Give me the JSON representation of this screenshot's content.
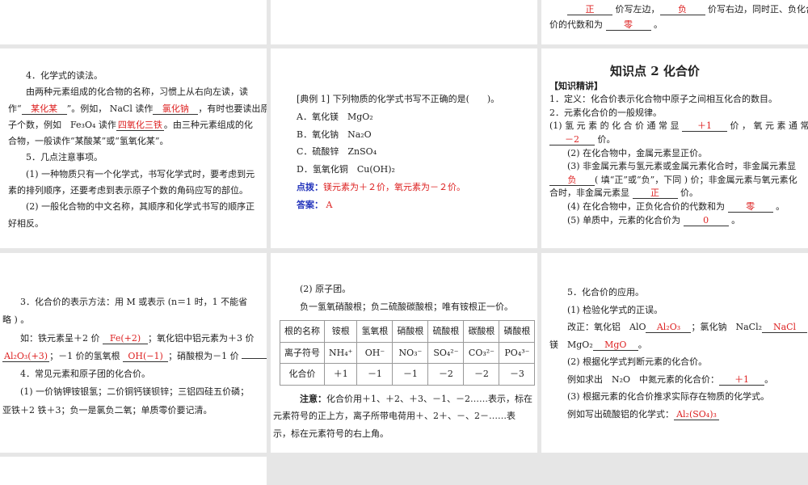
{
  "panels": [
    {
      "lines": []
    },
    {
      "lines": []
    },
    {
      "lines": [
        [
          {
            "t": "　　"
          },
          {
            "t": "正",
            "k": "blank"
          },
          {
            "t": " 价写左边，"
          },
          {
            "t": "负",
            "k": "blank"
          },
          {
            "t": " 价写右边，同时正、负化合"
          }
        ],
        [
          {
            "t": "价的代数和为 "
          },
          {
            "t": "零",
            "k": "blank"
          },
          {
            "t": " 。"
          }
        ]
      ]
    },
    {
      "lines": [
        [
          {
            "t": "　　4．化学式的读法。"
          }
        ],
        [
          {
            "t": "　　由两种元素组成的化合物的名称，习惯上从右向左读，读"
          }
        ],
        [
          {
            "t": "作“"
          },
          {
            "t": "某化某",
            "k": "blank"
          },
          {
            "t": "”。例如， NaCl 读作"
          },
          {
            "t": "氯化钠",
            "k": "blank"
          },
          {
            "t": "，有时也要读出原"
          }
        ],
        [
          {
            "t": "子个数，例如　Fe₃O₄ 读作"
          },
          {
            "t": "四氧化三铁",
            "k": "blank"
          },
          {
            "t": "。由三种元素组成的化"
          }
        ],
        [
          {
            "t": "合物，一般读作“某酸某”或“氢氧化某”。"
          }
        ],
        [
          {
            "t": "　　5．几点注意事项。"
          }
        ],
        [
          {
            "t": "　　(1) 一种物质只有一个化学式，书写化学式时，要考虑到元"
          }
        ],
        [
          {
            "t": "素的排列顺序，还要考虑到表示原子个数的角码应写的部位。"
          }
        ],
        [
          {
            "t": "　　(2) 一般化合物的中文名称，其顺序和化学式书写的顺序正"
          }
        ],
        [
          {
            "t": "好相反。"
          }
        ]
      ]
    },
    {
      "lines": [
        [
          {
            "t": "[典例 1]  下列物质的化学式书写不正确的是(　　)。"
          }
        ],
        [
          {
            "t": "A．氧化镁　MgO₂"
          }
        ],
        [
          {
            "t": "B．氧化钠　Na₂O"
          }
        ],
        [
          {
            "t": "C．硫酸锌　ZnSO₄"
          }
        ],
        [
          {
            "t": "D．氢氧化铜　Cu(OH)₂"
          }
        ],
        [
          {
            "t": "点拨：",
            "k": "blue"
          },
          {
            "t": "镁元素为＋２价，氧元素为－２价。",
            "k": "red"
          }
        ],
        [
          {
            "t": "答案：",
            "k": "blue"
          },
          {
            "t": " A",
            "k": "red"
          }
        ]
      ]
    },
    {
      "lines": [
        [
          {
            "t": "　　　　　知识点 2 化合价",
            "k": "big"
          }
        ],
        [
          {
            "t": "【知识精讲】",
            "k": "bold"
          }
        ],
        [
          {
            "t": "1．定义：化合价表示化合物中原子之间相互化合的数目。"
          }
        ],
        [
          {
            "t": "2．元素化合价的一般规律。"
          }
        ],
        [
          {
            "t": "(1) 氢 元 素 的 化 合 价 通 常 显 "
          },
          {
            "t": "＋1",
            "k": "blank"
          },
          {
            "t": " 价 ， 氧 元 素 通 常"
          }
        ],
        [
          {
            "t": "－2",
            "k": "blank"
          },
          {
            "t": " 价。"
          }
        ],
        [
          {
            "t": "　　(2) 在化合物中，金属元素显正价。"
          }
        ],
        [
          {
            "t": "　　(3) 非金属元素与氢元素或金属元素化合时，非金属元素显"
          }
        ],
        [
          {
            "t": "负",
            "k": "blank"
          },
          {
            "t": "( 填“正”或“负”，下同 ) 价；非金属元素与氧元素化"
          }
        ],
        [
          {
            "t": "合时，非金属元素显 "
          },
          {
            "t": "正",
            "k": "blank"
          },
          {
            "t": " 价。"
          }
        ],
        [
          {
            "t": "　　(4) 在化合物中，正负化合价的代数和为 "
          },
          {
            "t": "零",
            "k": "blank"
          },
          {
            "t": " 。"
          }
        ],
        [
          {
            "t": "　　(5) 单质中，元素的化合价为 "
          },
          {
            "t": "0",
            "k": "blank"
          },
          {
            "t": " 。"
          }
        ]
      ]
    },
    {
      "lines": [
        [
          {
            "t": "　　3．化合价的表示方法：用 M 或表示 (n＝1 时，1 不能省"
          }
        ],
        [
          {
            "t": "略 ) 。"
          }
        ],
        [
          {
            "t": "　　如：铁元素呈＋2 价 "
          },
          {
            "t": "Fe(+2)",
            "k": "blank"
          },
          {
            "t": "；氧化铝中铝元素为＋3 价"
          }
        ],
        [
          {
            "t": "Al₂O₃(+3)",
            "k": "blank"
          },
          {
            "t": "；－1 价的氢氧根 "
          },
          {
            "t": "OH(−1)",
            "k": "blank"
          },
          {
            "t": "；硝酸根为－1 价 "
          },
          {
            "t": "",
            "k": "blank"
          },
          {
            "t": "。"
          }
        ],
        [
          {
            "t": "　　4．常见元素和原子团的化合价。"
          }
        ],
        [
          {
            "t": "　　(1) 一价钠钾铵银氢；二价铜钙镁钡锌；三铝四硅五价磷；"
          }
        ],
        [
          {
            "t": "亚铁＋2 铁＋3；负一是氯负二氧；单质零价要记清。"
          }
        ]
      ]
    },
    {
      "lines": [
        [
          {
            "t": "　　　(2) 原子团。"
          }
        ],
        [
          {
            "t": "　　　负一氢氧硝酸根；负二硫酸碳酸根；唯有铵根正一价。"
          }
        ]
      ],
      "after": [
        [
          {
            "t": "　　　"
          },
          {
            "t": "注意：",
            "k": "bold"
          },
          {
            "t": "化合价用＋1、＋2、＋3、－1、－2……表示，标在"
          }
        ],
        [
          {
            "t": "元素符号的正上方，离子所带电荷用＋、2＋、－、2－……表"
          }
        ],
        [
          {
            "t": "示，标在元素符号的右上角。"
          }
        ]
      ]
    },
    {
      "lines": [
        [
          {
            "t": "　　5．化合价的应用。"
          }
        ],
        [
          {
            "t": "　　(1) 检验化学式的正误。"
          }
        ],
        [
          {
            "t": "　　改正：氧化铝　AlO"
          },
          {
            "t": "Al₂O₃",
            "k": "blank"
          },
          {
            "t": "；氯化钠　NaCl₂"
          },
          {
            "t": "NaCl",
            "k": "blank"
          },
          {
            "t": "；氧化"
          }
        ],
        [
          {
            "t": "镁　MgO₂"
          },
          {
            "t": "MgO",
            "k": "blank"
          },
          {
            "t": "。"
          }
        ],
        [
          {
            "t": "　　(2) 根据化学式判断元素的化合价。"
          }
        ],
        [
          {
            "t": "　　例如求出　N₂O　中氮元素的化合价："
          },
          {
            "t": "＋1",
            "k": "blank"
          },
          {
            "t": "。"
          }
        ],
        [
          {
            "t": "　　(3) 根据元素的化合价推求实际存在物质的化学式。"
          }
        ],
        [
          {
            "t": "　　例如写出硫酸铝的化学式："
          },
          {
            "t": "Al₂(SO₄)₃",
            "k": "blank"
          }
        ]
      ]
    },
    {
      "lines": []
    }
  ],
  "ion_table": {
    "rows": [
      [
        "根的名称",
        "铵根",
        "氢氧根",
        "硝酸根",
        "硫酸根",
        "碳酸根",
        "磷酸根"
      ],
      [
        "离子符号",
        "NH₄⁺",
        "OH⁻",
        "NO₃⁻",
        "SO₄²⁻",
        "CO₃²⁻",
        "PO₄³⁻"
      ],
      [
        "化合价",
        "＋1",
        "－1",
        "－1",
        "－2",
        "－2",
        "－3"
      ]
    ]
  }
}
